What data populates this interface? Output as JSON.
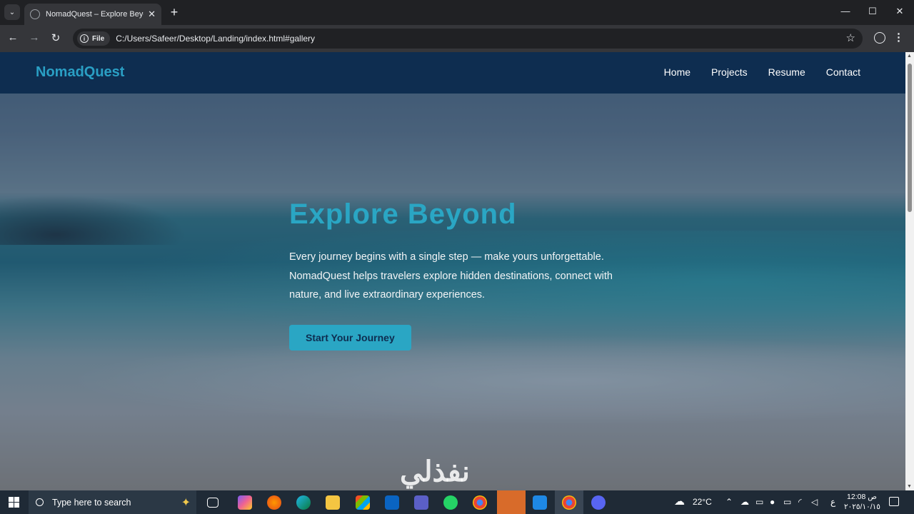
{
  "browser": {
    "tab_title": "NomadQuest – Explore Beyond",
    "address_chip": "File",
    "url": "C:/Users/Safeer/Desktop/Landing/index.html#gallery"
  },
  "site": {
    "logo": "NomadQuest",
    "nav": [
      "Home",
      "Projects",
      "Resume",
      "Contact"
    ],
    "hero": {
      "title": "Explore Beyond",
      "line1": "Every journey begins with a single step — make yours unforgettable.",
      "line2": "NomadQuest helps travelers explore hidden destinations, connect with",
      "line3": "nature, and live extraordinary experiences.",
      "cta": "Start Your Journey"
    },
    "watermark": "نفذلي"
  },
  "taskbar": {
    "search_placeholder": "Type here to search",
    "weather": "22°C",
    "lang": "ع",
    "time": "12:08 ص",
    "date": "٢٠٢٥/١٠/١٥"
  },
  "colors": {
    "accent": "#2aa6c4",
    "header_bg": "#0e2d50",
    "chrome_dark": "#202124",
    "chrome_toolbar": "#35363a",
    "taskbar_bg": "#1f2a36"
  },
  "icons": {
    "tab_favicon": "globe-icon",
    "new_tab": "plus-icon",
    "back": "arrow-left-icon",
    "forward": "arrow-right-icon",
    "reload": "reload-icon",
    "bookmark": "star-icon",
    "profile": "profile-icon",
    "menu": "kebab-menu-icon"
  }
}
